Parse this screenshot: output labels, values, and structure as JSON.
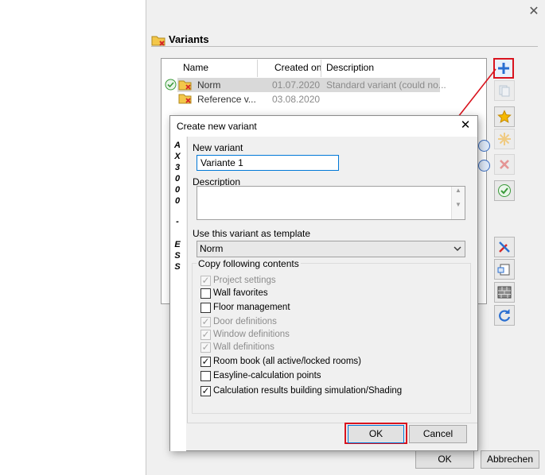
{
  "outer": {
    "title": "Variants",
    "close_glyph": "✕",
    "columns": [
      "Name",
      "Created on",
      "Description"
    ],
    "rows": [
      {
        "name": "Norm",
        "created": "01.07.2020",
        "description": "Standard variant (could no..."
      },
      {
        "name": "Reference v...",
        "created": "03.08.2020",
        "description": ""
      }
    ],
    "ok_label": "OK",
    "cancel_label": "Abbrechen",
    "vertical_text": [
      "A",
      "X",
      "3",
      "0",
      "0",
      "0",
      "-",
      "E",
      "S",
      "S"
    ],
    "toolbar_icons": [
      "add-icon",
      "copy-icon",
      "star-icon",
      "sparkle-icon",
      "delete-icon",
      "check-icon",
      "tools-icon",
      "export-icon",
      "wall-icon",
      "refresh-icon"
    ],
    "accent_color": "#d9141e"
  },
  "dialog": {
    "title": "Create new variant",
    "close_glyph": "✕",
    "new_variant_label": "New variant",
    "new_variant_value": "Variante 1",
    "description_label": "Description",
    "description_value": "",
    "template_label": "Use this variant as template",
    "template_value": "Norm",
    "copy_label": "Copy following contents",
    "options": [
      {
        "label": "Project settings",
        "checked": true,
        "enabled": false
      },
      {
        "label": "Wall favorites",
        "checked": false,
        "enabled": true
      },
      {
        "label": "Floor management",
        "checked": false,
        "enabled": true
      },
      {
        "label": "Door definitions",
        "checked": true,
        "enabled": false
      },
      {
        "label": "Window definitions",
        "checked": true,
        "enabled": false
      },
      {
        "label": "Wall definitions",
        "checked": true,
        "enabled": false
      },
      {
        "label": "Room book (all active/locked rooms)",
        "checked": true,
        "enabled": true
      },
      {
        "label": "Easyline-calculation points",
        "checked": false,
        "enabled": true
      },
      {
        "label": "Calculation results building simulation/Shading",
        "checked": true,
        "enabled": true
      }
    ],
    "ok_label": "OK",
    "cancel_label": "Cancel"
  }
}
